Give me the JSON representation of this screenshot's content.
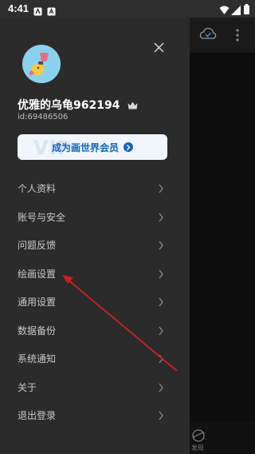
{
  "status_bar": {
    "time": "4:41",
    "icons": [
      "notification-a-icon",
      "notification-b-icon",
      "wifi-icon",
      "signal-icon",
      "battery-icon"
    ]
  },
  "drawer": {
    "username": "优雅的乌龟962194",
    "user_id": "id:69486506",
    "vip_banner": {
      "label": "成为画世界会员",
      "watermark": "VIP"
    },
    "menu_items": [
      {
        "label": "个人资料"
      },
      {
        "label": "账号与安全"
      },
      {
        "label": "问题反馈"
      },
      {
        "label": "绘画设置"
      },
      {
        "label": "通用设置"
      },
      {
        "label": "数据备份"
      },
      {
        "label": "系统通知"
      },
      {
        "label": "关于"
      },
      {
        "label": "退出登录"
      }
    ]
  },
  "background_app": {
    "bottom_nav_label": "发现"
  },
  "colors": {
    "drawer_bg": "#2b2b2b",
    "vip_accent": "#1565c0",
    "annotation": "#cc1f1f"
  }
}
